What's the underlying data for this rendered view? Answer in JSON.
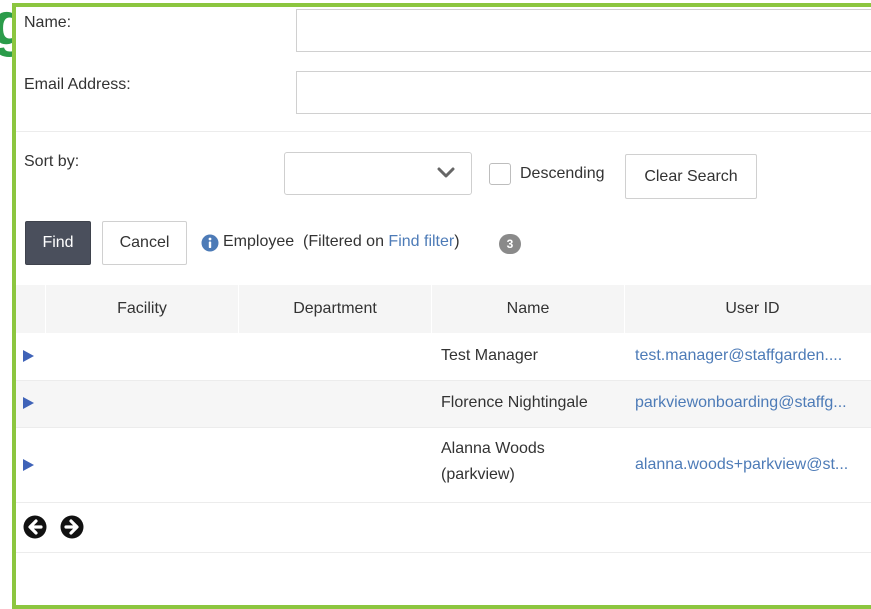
{
  "form": {
    "name_label": "Name:",
    "name_value": "",
    "email_label": "Email Address:",
    "email_value": "",
    "sort_label": "Sort by:",
    "sort_value": "",
    "descending_label": "Descending",
    "descending_checked": false,
    "clear_label": "Clear Search"
  },
  "actions": {
    "find_label": "Find",
    "cancel_label": "Cancel"
  },
  "result": {
    "entity": "Employee",
    "filter_prefix": "(Filtered on ",
    "filter_link": "Find filter",
    "filter_suffix": ")",
    "count": "3"
  },
  "table": {
    "columns": [
      "Facility",
      "Department",
      "Name",
      "User ID"
    ],
    "rows": [
      {
        "facility": "",
        "department": "",
        "name": "Test Manager",
        "user_id": "test.manager@staffgarden...."
      },
      {
        "facility": "",
        "department": "",
        "name": "Florence Nightingale",
        "user_id": "parkviewonboarding@staffg..."
      },
      {
        "facility": "",
        "department": "",
        "name": "Alanna Woods (parkview)",
        "user_id": "alanna.woods+parkview@st..."
      }
    ]
  },
  "background_letter": "g",
  "colors": {
    "frame_border": "#8cc63f",
    "find_button": "#4a4f5c",
    "link": "#4d7bb7",
    "row_arrow": "#3f63b8",
    "badge": "#8a8a8a"
  },
  "icons": {
    "info": "info-circle-icon",
    "chevron": "chevron-down-icon",
    "expand": "expand-row-triangle-icon",
    "prev": "arrow-circle-left-icon",
    "next": "arrow-circle-right-icon"
  }
}
